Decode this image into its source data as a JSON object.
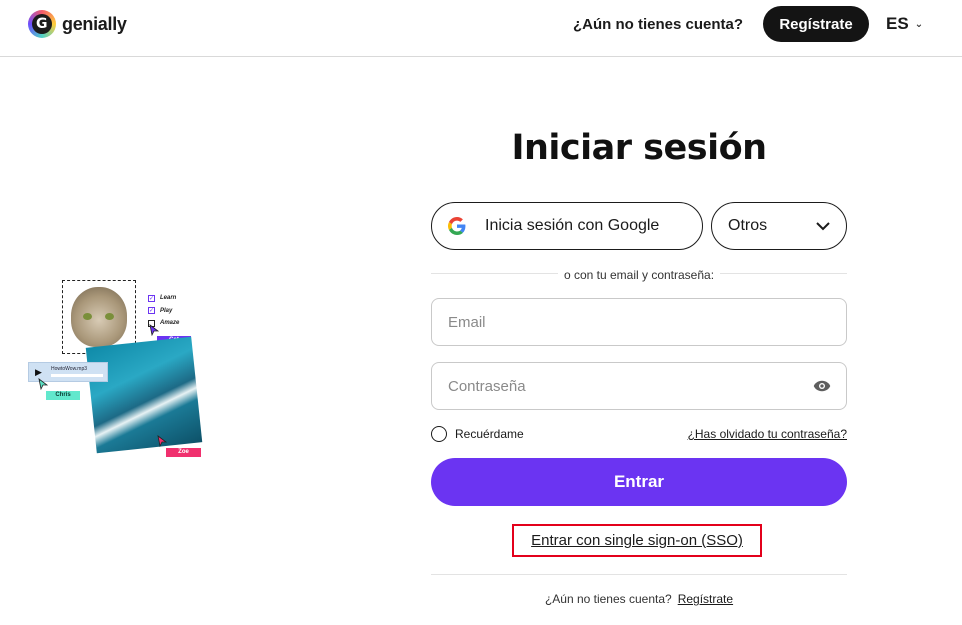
{
  "header": {
    "logo_text": "genially",
    "question": "¿Aún no tienes cuenta?",
    "register_label": "Regístrate",
    "language": "ES"
  },
  "login": {
    "title": "Iniciar sesión",
    "google_label": "Inicia sesión con Google",
    "others_label": "Otros",
    "divider_text": "o con tu email y contraseña:",
    "email_placeholder": "Email",
    "password_placeholder": "Contraseña",
    "remember_label": "Recuérdame",
    "forgot_label": "¿Has olvidado tu contraseña?",
    "enter_label": "Entrar",
    "sso_label": "Entrar con single sign-on (SSO)",
    "bottom_question": "¿Aún no tienes cuenta?",
    "bottom_register": "Regístrate"
  },
  "illustration": {
    "checklist": [
      "Learn",
      "Play",
      "Amaze"
    ],
    "tags": {
      "cat": "Cat",
      "chris": "Chris",
      "zoe": "Zoe"
    },
    "player_file": "HowtoWow.mp3"
  },
  "colors": {
    "accent": "#6b34f2",
    "dark_button": "#141414",
    "highlight_box": "#e3001b"
  }
}
